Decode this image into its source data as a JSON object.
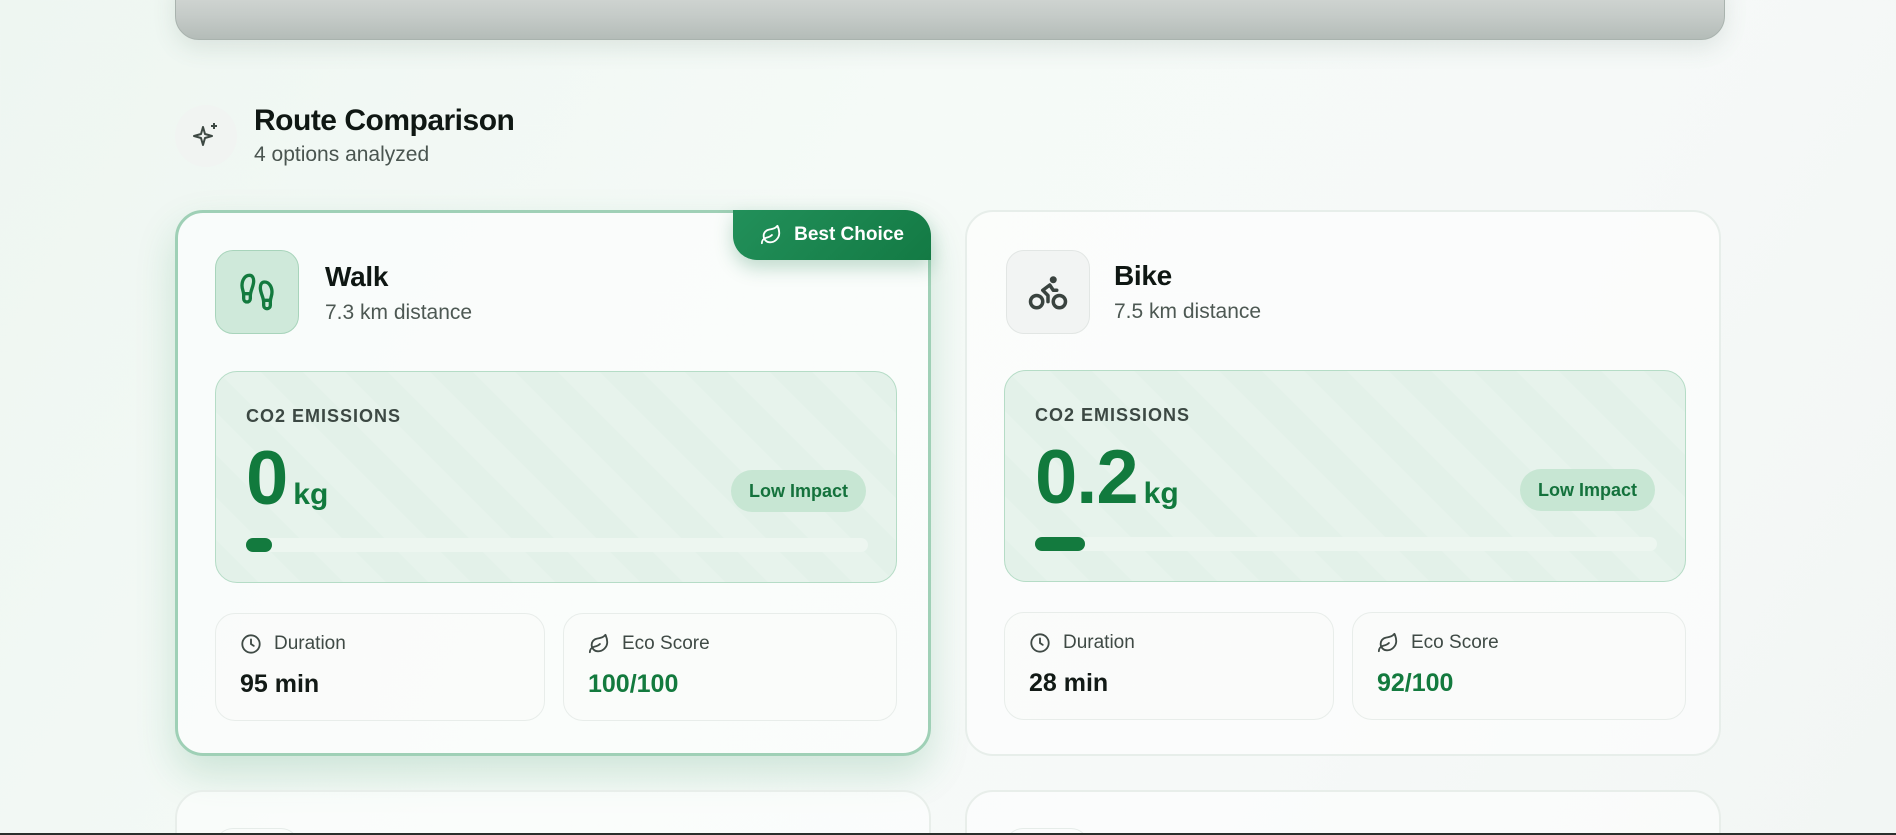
{
  "section": {
    "title": "Route Comparison",
    "subtitle": "4 options analyzed"
  },
  "routes": [
    {
      "mode": "Walk",
      "distance": "7.3 km distance",
      "best": true,
      "badge": "Best Choice",
      "emissions_label": "CO2 EMISSIONS",
      "emissions_value": "0",
      "emissions_unit": "kg",
      "impact": "Low Impact",
      "emissions_bar_fraction": 0.0,
      "duration_label": "Duration",
      "duration": "95 min",
      "eco_label": "Eco Score",
      "eco_score": "100/100",
      "icon": "footprints-icon"
    },
    {
      "mode": "Bike",
      "distance": "7.5 km distance",
      "best": false,
      "emissions_label": "CO2 EMISSIONS",
      "emissions_value": "0.2",
      "emissions_unit": "kg",
      "impact": "Low Impact",
      "emissions_bar_fraction": 0.08,
      "duration_label": "Duration",
      "duration": "28 min",
      "eco_label": "Eco Score",
      "eco_score": "92/100",
      "icon": "bike-icon"
    }
  ],
  "colors": {
    "accent": "#137a3e",
    "badge": "#1d8a52",
    "pill_bg": "#c7e6d3"
  }
}
